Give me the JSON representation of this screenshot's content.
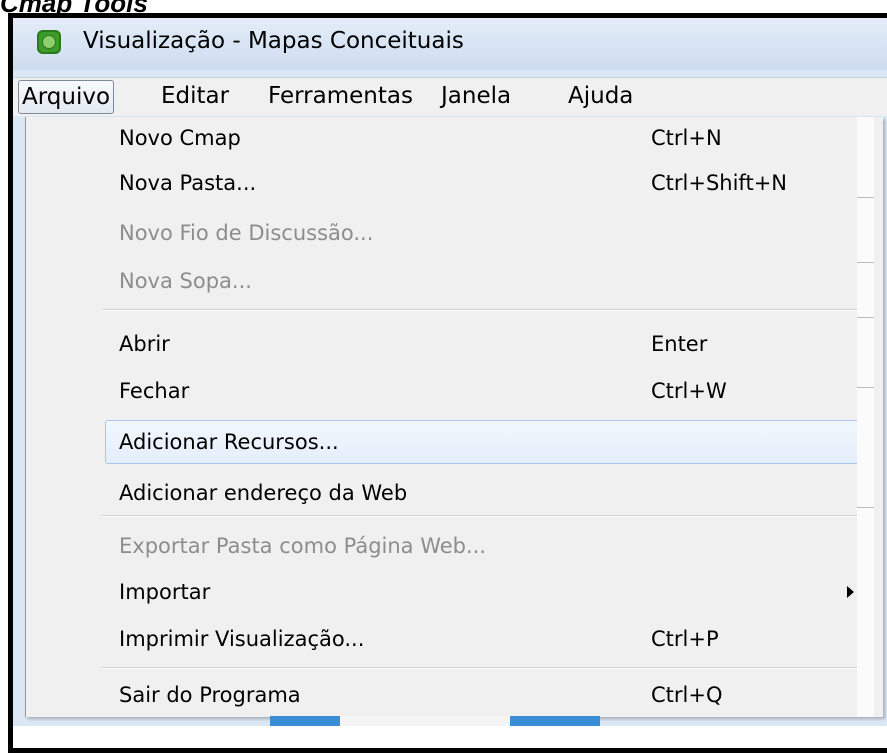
{
  "caption": "Cmap Tools",
  "window": {
    "title": "Visualização - Mapas Conceituais",
    "icon": "cmaptools-app-icon"
  },
  "menubar": {
    "items": [
      "Arquivo",
      "Editar",
      "Ferramentas",
      "Janela",
      "Ajuda"
    ],
    "active": "Arquivo"
  },
  "file_menu": {
    "items": [
      {
        "label": "Novo Cmap",
        "shortcut": "Ctrl+N"
      },
      {
        "label": "Nova Pasta...",
        "shortcut": "Ctrl+Shift+N"
      },
      {
        "label": "Novo Fio de Discussão...",
        "shortcut": "",
        "disabled": true
      },
      {
        "label": "Nova Sopa...",
        "shortcut": "",
        "disabled": true
      },
      {
        "label": "Abrir",
        "shortcut": "Enter"
      },
      {
        "label": "Fechar",
        "shortcut": "Ctrl+W"
      },
      {
        "label": "Adicionar Recursos...",
        "shortcut": "",
        "highlighted": true
      },
      {
        "label": "Adicionar endereço da Web",
        "shortcut": ""
      },
      {
        "label": "Exportar Pasta como Página Web...",
        "shortcut": "",
        "disabled": true
      },
      {
        "label": "Importar",
        "shortcut": "",
        "submenu": true
      },
      {
        "label": "Imprimir Visualização...",
        "shortcut": "Ctrl+P"
      },
      {
        "label": "Sair do Programa",
        "shortcut": "Ctrl+Q"
      }
    ]
  },
  "colors": {
    "disabled_text": "#8d8d8d",
    "highlight_border": "#a8c7ea",
    "titlebar": "#d6e3f3"
  }
}
